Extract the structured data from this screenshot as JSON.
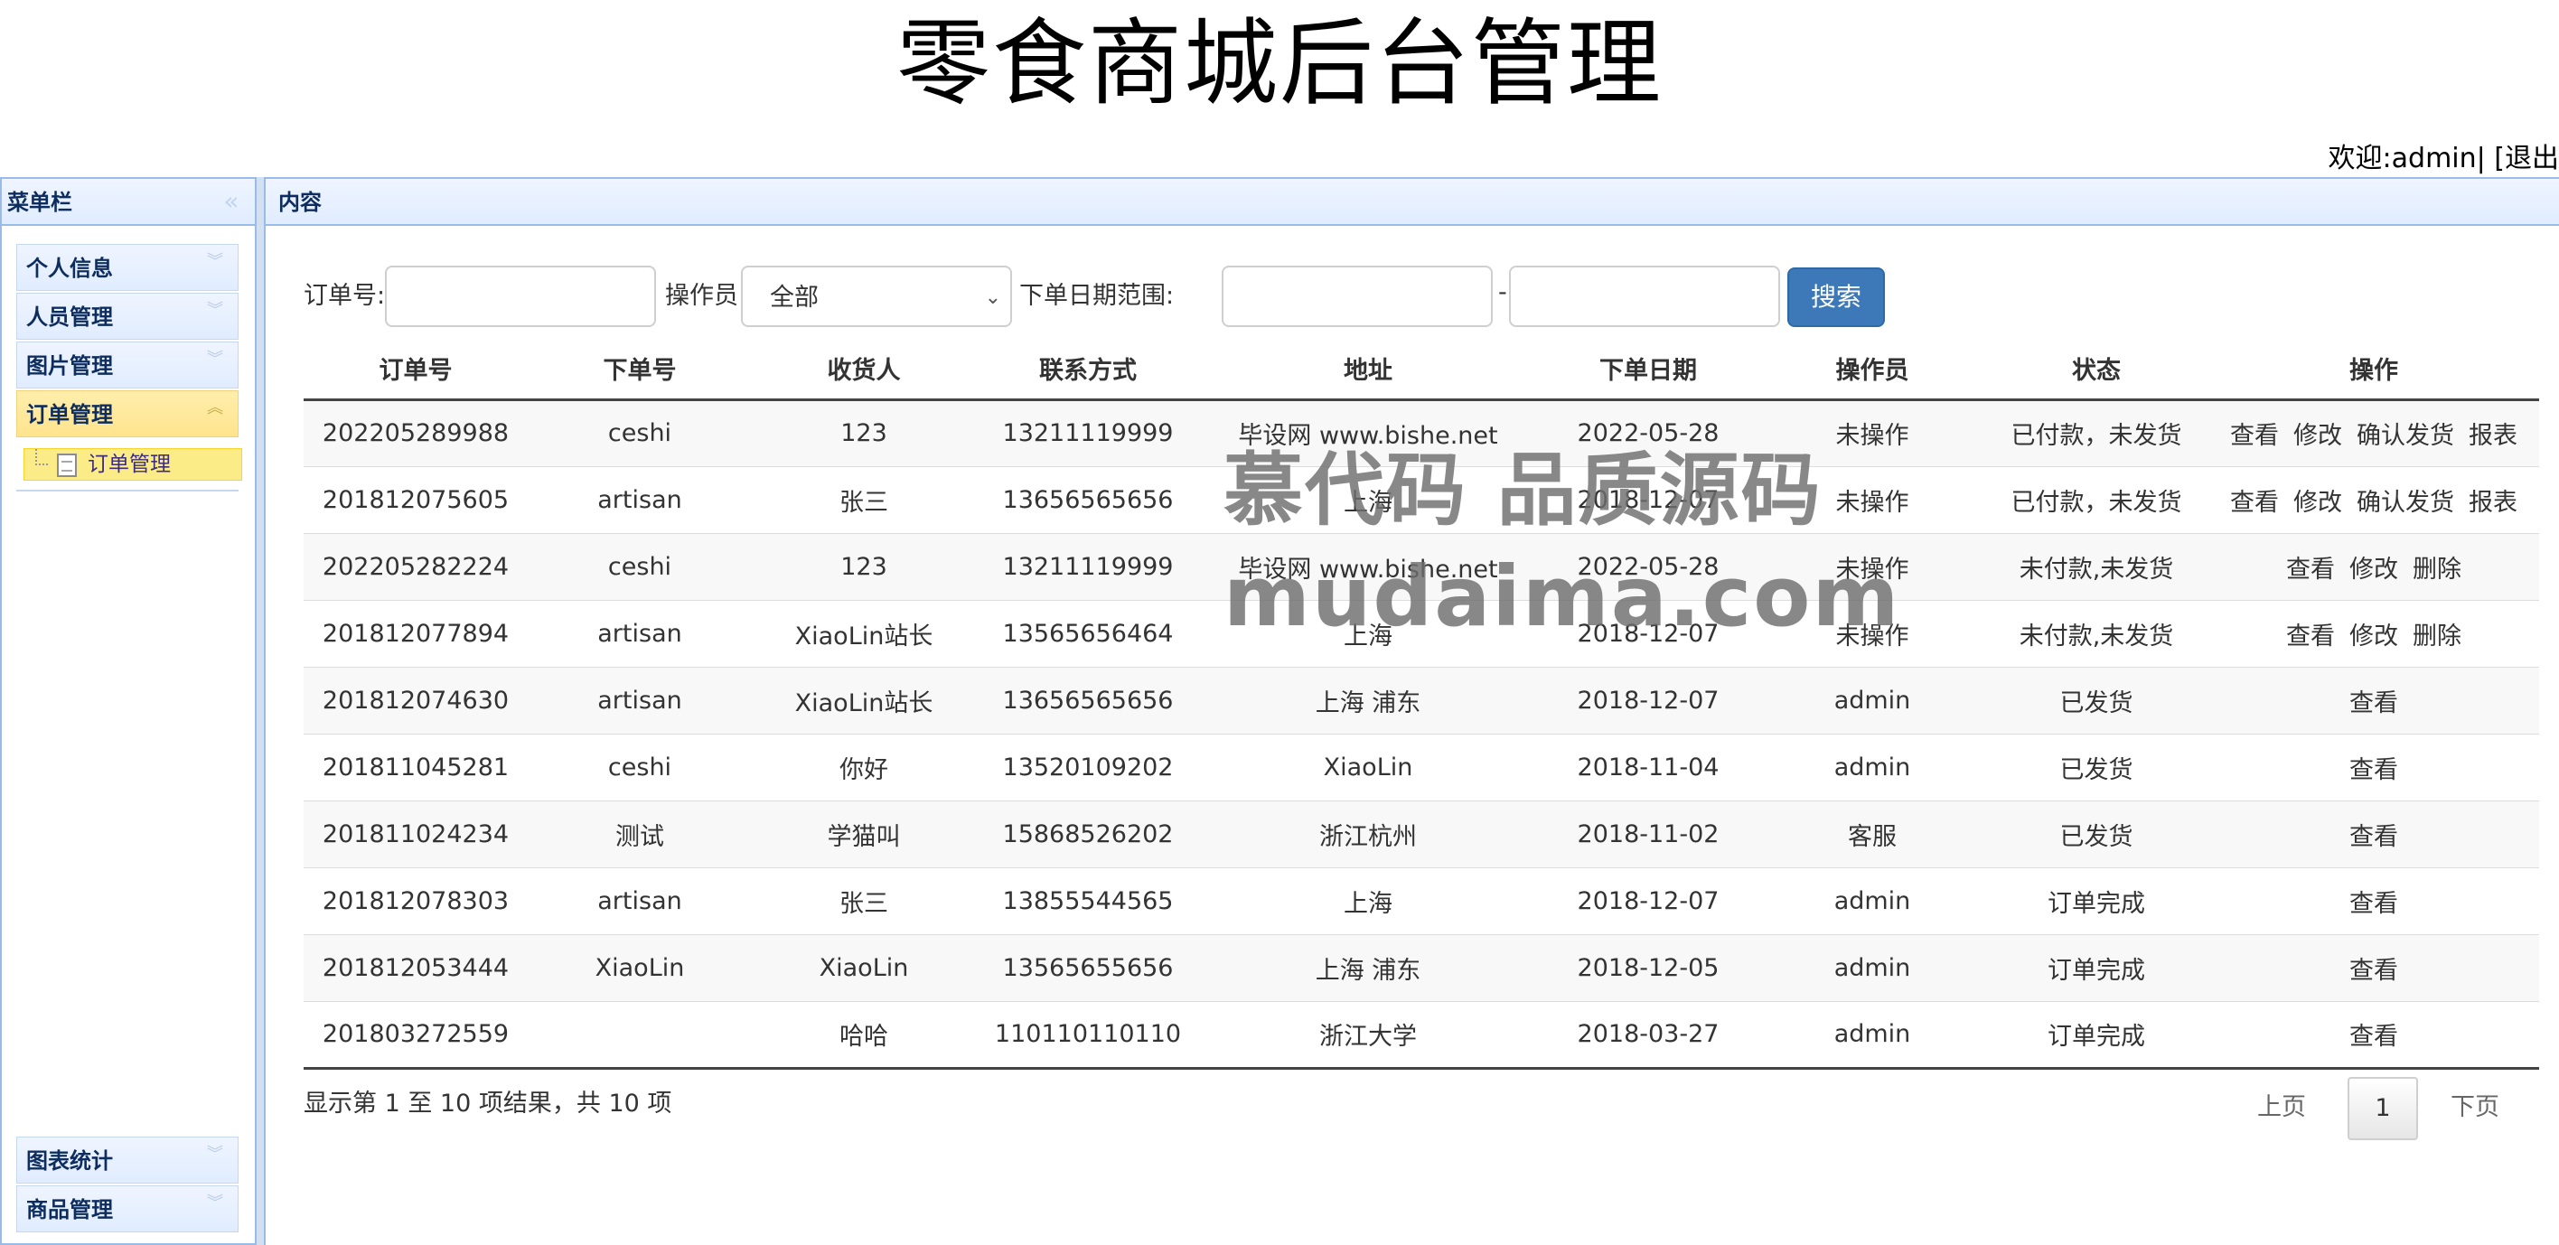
{
  "header": {
    "title": "零食商城后台管理",
    "welcome": "欢迎:admin| [退出"
  },
  "west": {
    "title": "菜单栏",
    "collapse_icon": "double-chevron-left-icon",
    "menu": [
      {
        "label": "个人信息",
        "selected": false
      },
      {
        "label": "人员管理",
        "selected": false
      },
      {
        "label": "图片管理",
        "selected": false
      },
      {
        "label": "订单管理",
        "selected": true,
        "children": [
          "订单管理"
        ]
      }
    ],
    "menu_bottom": [
      {
        "label": "图表统计"
      },
      {
        "label": "商品管理"
      }
    ]
  },
  "center": {
    "title": "内容"
  },
  "search": {
    "order_no_label": "订单号:",
    "operator_label": "操作员:",
    "operator_value": "全部",
    "date_range_label": "下单日期范围:",
    "date_sep": "-",
    "button": "搜索"
  },
  "table": {
    "columns": [
      "订单号",
      "下单号",
      "收货人",
      "联系方式",
      "地址",
      "下单日期",
      "操作员",
      "状态",
      "操作"
    ],
    "rows": [
      {
        "order_no": "202205289988",
        "buyer": "ceshi",
        "receiver": "123",
        "phone": "13211119999",
        "address": "毕设网 www.bishe.net",
        "date": "2022-05-28",
        "operator": "未操作",
        "status": "已付款，未发货",
        "actions": [
          "查看",
          "修改",
          "确认发货",
          "报表"
        ]
      },
      {
        "order_no": "201812075605",
        "buyer": "artisan",
        "receiver": "张三",
        "phone": "13656565656",
        "address": "上海",
        "date": "2018-12-07",
        "operator": "未操作",
        "status": "已付款，未发货",
        "actions": [
          "查看",
          "修改",
          "确认发货",
          "报表"
        ]
      },
      {
        "order_no": "202205282224",
        "buyer": "ceshi",
        "receiver": "123",
        "phone": "13211119999",
        "address": "毕设网 www.bishe.net",
        "date": "2022-05-28",
        "operator": "未操作",
        "status": "未付款,未发货",
        "actions": [
          "查看",
          "修改",
          "删除"
        ]
      },
      {
        "order_no": "201812077894",
        "buyer": "artisan",
        "receiver": "XiaoLin站长",
        "phone": "13565656464",
        "address": "上海",
        "date": "2018-12-07",
        "operator": "未操作",
        "status": "未付款,未发货",
        "actions": [
          "查看",
          "修改",
          "删除"
        ]
      },
      {
        "order_no": "201812074630",
        "buyer": "artisan",
        "receiver": "XiaoLin站长",
        "phone": "13656565656",
        "address": "上海 浦东",
        "date": "2018-12-07",
        "operator": "admin",
        "status": "已发货",
        "actions": [
          "查看"
        ]
      },
      {
        "order_no": "201811045281",
        "buyer": "ceshi",
        "receiver": "你好",
        "phone": "13520109202",
        "address": "XiaoLin",
        "date": "2018-11-04",
        "operator": "admin",
        "status": "已发货",
        "actions": [
          "查看"
        ]
      },
      {
        "order_no": "201811024234",
        "buyer": "测试",
        "receiver": "学猫叫",
        "phone": "15868526202",
        "address": "浙江杭州",
        "date": "2018-11-02",
        "operator": "客服",
        "status": "已发货",
        "actions": [
          "查看"
        ]
      },
      {
        "order_no": "201812078303",
        "buyer": "artisan",
        "receiver": "张三",
        "phone": "13855544565",
        "address": "上海",
        "date": "2018-12-07",
        "operator": "admin",
        "status": "订单完成",
        "actions": [
          "查看"
        ]
      },
      {
        "order_no": "201812053444",
        "buyer": "XiaoLin",
        "receiver": "XiaoLin",
        "phone": "13565655656",
        "address": "上海 浦东",
        "date": "2018-12-05",
        "operator": "admin",
        "status": "订单完成",
        "actions": [
          "查看"
        ]
      },
      {
        "order_no": "201803272559",
        "buyer": "",
        "receiver": "哈哈",
        "phone": "110110110110",
        "address": "浙江大学",
        "date": "2018-03-27",
        "operator": "admin",
        "status": "订单完成",
        "actions": [
          "查看"
        ]
      }
    ]
  },
  "footer": {
    "info": "显示第 1 至 10 项结果，共 10 项",
    "prev": "上页",
    "current_page": "1",
    "next": "下页"
  },
  "watermark": {
    "line1": "慕代码 品质源码",
    "line2": "mudaima.com"
  }
}
